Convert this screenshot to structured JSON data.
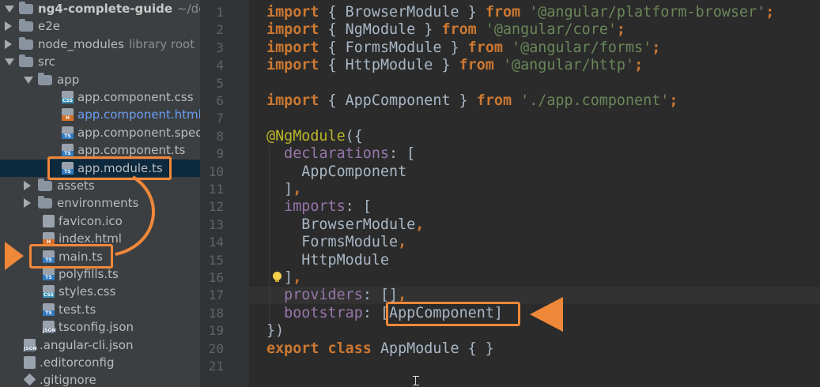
{
  "project": {
    "root_name": "ng4-complete-guide",
    "root_path": "~/develo",
    "items": [
      {
        "label": "e2e",
        "kind": "folder",
        "depth": 0,
        "expanded": false
      },
      {
        "label": "node_modules",
        "kind": "folder",
        "depth": 0,
        "expanded": false,
        "hint": "library root"
      },
      {
        "label": "src",
        "kind": "folder",
        "depth": 0,
        "expanded": true
      },
      {
        "label": "app",
        "kind": "folder",
        "depth": 1,
        "expanded": true
      },
      {
        "label": "app.component.css",
        "kind": "file",
        "depth": 2,
        "tag": "CSS"
      },
      {
        "label": "app.component.html",
        "kind": "file",
        "depth": 2,
        "tag": "H",
        "modified": true
      },
      {
        "label": "app.component.spec.",
        "kind": "file",
        "depth": 2,
        "tag": "TS"
      },
      {
        "label": "app.component.ts",
        "kind": "file",
        "depth": 2,
        "tag": "TS"
      },
      {
        "label": "app.module.ts",
        "kind": "file",
        "depth": 2,
        "tag": "TS",
        "selected": true
      },
      {
        "label": "assets",
        "kind": "folder",
        "depth": 1,
        "expanded": false
      },
      {
        "label": "environments",
        "kind": "folder",
        "depth": 1,
        "expanded": false
      },
      {
        "label": "favicon.ico",
        "kind": "file",
        "depth": 1,
        "tag": ""
      },
      {
        "label": "index.html",
        "kind": "file",
        "depth": 1,
        "tag": "H"
      },
      {
        "label": "main.ts",
        "kind": "file",
        "depth": 1,
        "tag": "TS"
      },
      {
        "label": "polyfills.ts",
        "kind": "file",
        "depth": 1,
        "tag": "TS"
      },
      {
        "label": "styles.css",
        "kind": "file",
        "depth": 1,
        "tag": "CSS"
      },
      {
        "label": "test.ts",
        "kind": "file",
        "depth": 1,
        "tag": "TS"
      },
      {
        "label": "tsconfig.json",
        "kind": "file",
        "depth": 1,
        "tag": "JSON"
      },
      {
        "label": ".angular-cli.json",
        "kind": "file",
        "depth": 0,
        "tag": "JSON"
      },
      {
        "label": ".editorconfig",
        "kind": "file",
        "depth": 0,
        "tag": ""
      },
      {
        "label": ".gitignore",
        "kind": "git",
        "depth": 0,
        "tag": ""
      }
    ]
  },
  "editor": {
    "lines": [
      [
        [
          "kw",
          "import"
        ],
        [
          "br",
          " { BrowserModule } "
        ],
        [
          "kw",
          "from"
        ],
        [
          "br",
          " "
        ],
        [
          "str",
          "'@angular/platform-browser'"
        ],
        [
          "kw",
          ";"
        ]
      ],
      [
        [
          "kw",
          "import"
        ],
        [
          "br",
          " { NgModule } "
        ],
        [
          "kw",
          "from"
        ],
        [
          "br",
          " "
        ],
        [
          "str",
          "'@angular/core'"
        ],
        [
          "kw",
          ";"
        ]
      ],
      [
        [
          "kw",
          "import"
        ],
        [
          "br",
          " { FormsModule } "
        ],
        [
          "kw",
          "from"
        ],
        [
          "br",
          " "
        ],
        [
          "str",
          "'@angular/forms'"
        ],
        [
          "kw",
          ";"
        ]
      ],
      [
        [
          "kw",
          "import"
        ],
        [
          "br",
          " { HttpModule } "
        ],
        [
          "kw",
          "from"
        ],
        [
          "br",
          " "
        ],
        [
          "str",
          "'@angular/http'"
        ],
        [
          "kw",
          ";"
        ]
      ],
      [],
      [
        [
          "kw",
          "import"
        ],
        [
          "br",
          " { AppComponent } "
        ],
        [
          "kw",
          "from"
        ],
        [
          "br",
          " "
        ],
        [
          "str",
          "'./app.component'"
        ],
        [
          "kw",
          ";"
        ]
      ],
      [],
      [
        [
          "ann",
          "@NgModule"
        ],
        [
          "br",
          "({"
        ]
      ],
      [
        [
          "br",
          "  "
        ],
        [
          "prop",
          "declarations"
        ],
        [
          "br",
          ": ["
        ]
      ],
      [
        [
          "br",
          "    AppComponent"
        ]
      ],
      [
        [
          "br",
          "  ]"
        ],
        [
          "kw",
          ","
        ]
      ],
      [
        [
          "br",
          "  "
        ],
        [
          "prop",
          "imports"
        ],
        [
          "br",
          ": ["
        ]
      ],
      [
        [
          "br",
          "    BrowserModule"
        ],
        [
          "kw",
          ","
        ]
      ],
      [
        [
          "br",
          "    FormsModule"
        ],
        [
          "kw",
          ","
        ]
      ],
      [
        [
          "br",
          "    HttpModule"
        ]
      ],
      [
        [
          "br",
          "  ]"
        ],
        [
          "kw",
          ","
        ]
      ],
      [
        [
          "br",
          "  "
        ],
        [
          "prop",
          "providers"
        ],
        [
          "br",
          ": []"
        ],
        [
          "kw",
          ","
        ]
      ],
      [
        [
          "br",
          "  "
        ],
        [
          "prop",
          "bootstrap"
        ],
        [
          "br",
          ": [AppComponent]"
        ]
      ],
      [
        [
          "br",
          "})"
        ]
      ],
      [
        [
          "kw",
          "export class"
        ],
        [
          "br",
          " AppModule { }"
        ]
      ],
      []
    ]
  }
}
